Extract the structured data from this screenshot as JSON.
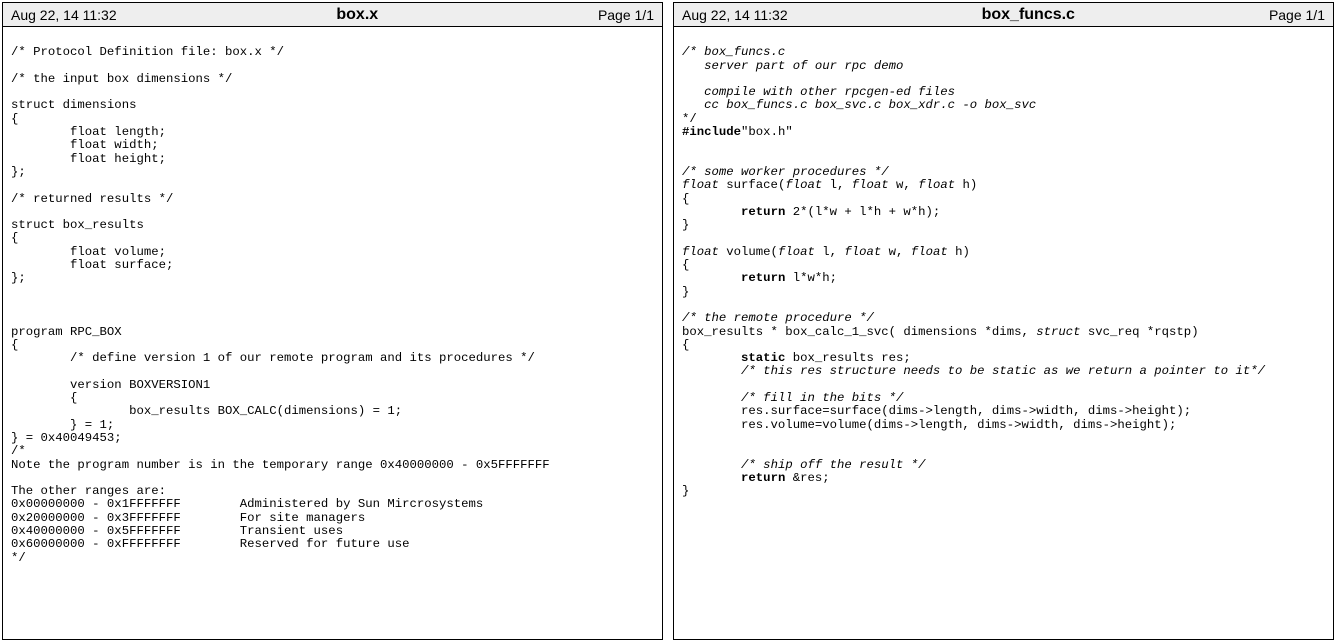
{
  "left": {
    "date": "Aug 22, 14 11:32",
    "title": "box.x",
    "pageno": "Page 1/1",
    "code": {
      "l01": "/* Protocol Definition file: box.x */",
      "l02": "",
      "l03": "/* the input box dimensions */",
      "l04": "",
      "l05": "struct dimensions",
      "l06": "{",
      "l07": "        float length;",
      "l08": "        float width;",
      "l09": "        float height;",
      "l10": "};",
      "l11": "",
      "l12": "/* returned results */",
      "l13": "",
      "l14": "struct box_results",
      "l15": "{",
      "l16": "        float volume;",
      "l17": "        float surface;",
      "l18": "};",
      "l19": "",
      "l20": "",
      "l21": "",
      "l22": "program RPC_BOX",
      "l23": "{",
      "l24": "        /* define version 1 of our remote program and its procedures */",
      "l25": "",
      "l26": "        version BOXVERSION1",
      "l27": "        {",
      "l28": "                box_results BOX_CALC(dimensions) = 1;",
      "l29": "        } = 1;",
      "l30": "} = 0x40049453;",
      "l31": "/*",
      "l32": "Note the program number is in the temporary range 0x40000000 - 0x5FFFFFFF",
      "l33": "",
      "l34": "The other ranges are:",
      "l35": "0x00000000 - 0x1FFFFFFF        Administered by Sun Mircrosystems",
      "l36": "0x20000000 - 0x3FFFFFFF        For site managers",
      "l37": "0x40000000 - 0x5FFFFFFF        Transient uses",
      "l38": "0x60000000 - 0xFFFFFFFF        Reserved for future use",
      "l39": "*/"
    }
  },
  "right": {
    "date": "Aug 22, 14 11:32",
    "title": "box_funcs.c",
    "pageno": "Page 1/1",
    "code": {
      "c01a": "/* box_funcs.c",
      "c01b": "   server part of our rpc demo",
      "c01c": "",
      "c01d": "   compile with other rpcgen-ed files",
      "c01e": "   cc box_funcs.c box_svc.c box_xdr.c -o box_svc",
      "c01f": "*/",
      "inc_kw": "#include",
      "inc_arg": "\"box.h\"",
      "blank1": "",
      "blank2": "",
      "c_sw": "/* some worker procedures */",
      "surf_t": "float",
      "surf_sig1": " surface(",
      "surf_p1t": "float",
      "surf_p1": " l, ",
      "surf_p2t": "float",
      "surf_p2": " w, ",
      "surf_p3t": "float",
      "surf_p3": " h)",
      "ob": "{",
      "ret1_pad": "        ",
      "ret1_kw": "return",
      "ret1_rest": " 2*(l*w + l*h + w*h);",
      "cb": "}",
      "blank3": "",
      "vol_t": "float",
      "vol_sig1": " volume(",
      "vol_p1t": "float",
      "vol_p1": " l, ",
      "vol_p2t": "float",
      "vol_p2": " w, ",
      "vol_p3t": "float",
      "vol_p3": " h)",
      "ob2": "{",
      "ret2_pad": "        ",
      "ret2_kw": "return",
      "ret2_rest": " l*w*h;",
      "cb2": "}",
      "blank4": "",
      "c_rp": "/* the remote procedure */",
      "bc_sig1": "box_results * box_calc_1_svc( dimensions *dims, ",
      "bc_struct": "struct",
      "bc_sig2": " svc_req *rqstp)",
      "ob3": "{",
      "st_pad": "        ",
      "st_kw": "static",
      "st_rest": " box_results res;",
      "c_static_pad": "        ",
      "c_static": "/* this res structure needs to be static as we return a pointer to it*/",
      "blank5": "",
      "c_fill_pad": "        ",
      "c_fill": "/* fill in the bits */",
      "assn1": "        res.surface=surface(dims->length, dims->width, dims->height);",
      "assn2": "        res.volume=volume(dims->length, dims->width, dims->height);",
      "blank6": "",
      "blank7": "",
      "c_ship_pad": "        ",
      "c_ship": "/* ship off the result */",
      "ret3_pad": "        ",
      "ret3_kw": "return",
      "ret3_rest": " &res;",
      "cb3": "}"
    }
  }
}
